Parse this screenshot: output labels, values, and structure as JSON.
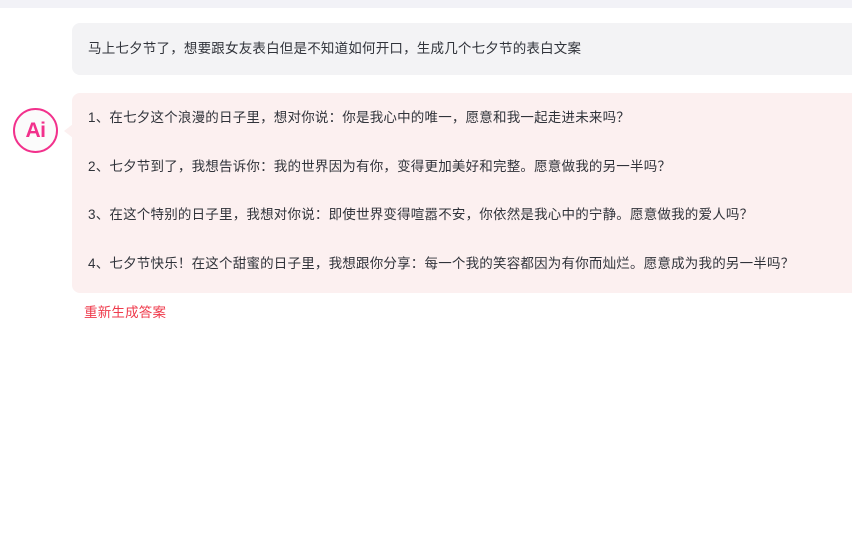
{
  "colors": {
    "page_background": "#ffffff",
    "top_strip": "#f2f2f7",
    "user_bubble": "#f3f3f5",
    "ai_bubble": "#fcf0f0",
    "avatar_accent": "#f2318c",
    "regenerate_link": "#ef3b4c",
    "body_text": "#30333a"
  },
  "conversation": {
    "user_message": {
      "text": "马上七夕节了，想要跟女友表白但是不知道如何开口，生成几个七夕节的表白文案"
    },
    "ai_message": {
      "avatar_label": "Ai",
      "avatar_icon": "ai-logo-icon",
      "lines": [
        "1、在七夕这个浪漫的日子里，想对你说：你是我心中的唯一，愿意和我一起走进未来吗？",
        "2、七夕节到了，我想告诉你：我的世界因为有你，变得更加美好和完整。愿意做我的另一半吗？",
        "3、在这个特别的日子里，我想对你说：即使世界变得喧嚣不安，你依然是我心中的宁静。愿意做我的爱人吗？",
        "4、七夕节快乐！在这个甜蜜的日子里，我想跟你分享：每一个我的笑容都因为有你而灿烂。愿意成为我的另一半吗？"
      ]
    }
  },
  "actions": {
    "regenerate_label": "重新生成答案"
  }
}
